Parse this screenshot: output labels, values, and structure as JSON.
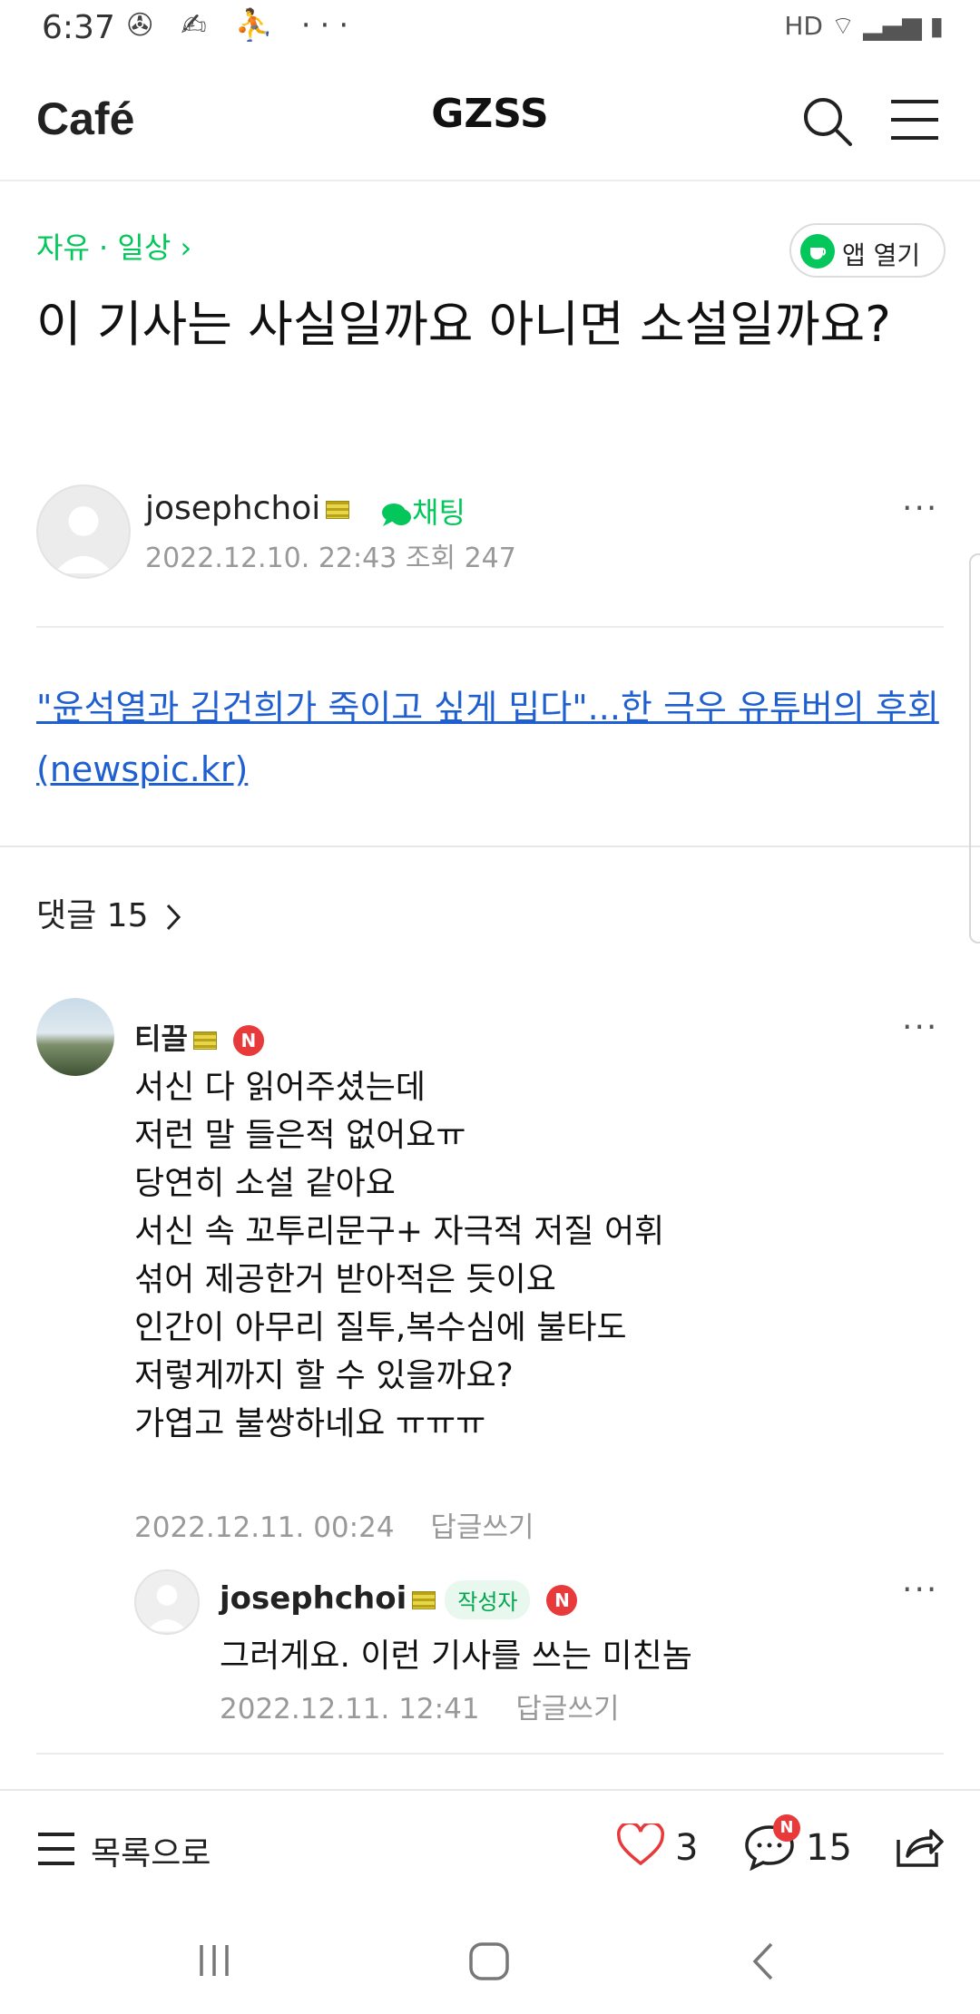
{
  "status": {
    "time": "6:37",
    "notification_icons": "✇ ✍ ⛹ ···",
    "right_icons": "HD ⌔ ▂▄▆ ▮"
  },
  "header": {
    "logo": "Café",
    "cafe_name": "GZSS"
  },
  "post": {
    "board": "자유 · 일상 ›",
    "app_open_label": "앱 열기",
    "title": "이 기사는 사실일까요 아니면 소설일까요?",
    "author": "josephchoi",
    "chat_label": "채팅",
    "date": "2022.12.10. 22:43",
    "views": "조회 247",
    "link_text": "\"윤석열과 김건희가 죽이고 싶게 밉다\"...한 극우 유튜버의 후회 (newspic.kr)",
    "comment_count_label": "댓글 15"
  },
  "comments": [
    {
      "name": "티끌",
      "new_badge": "N",
      "lines": [
        "서신 다 읽어주셨는데",
        "저런 말 들은적 없어요ㅠ",
        "당연히 소설 같아요",
        "서신 속 꼬투리문구+ 자극적 저질 어휘",
        "섞어 제공한거 받아적은 듯이요",
        "인간이 아무리 질투,복수심에 불타도",
        "저렇게까지 할 수 있을까요?",
        "가엽고 불쌍하네요 ㅠㅠㅠ"
      ],
      "date": "2022.12.11. 00:24",
      "reply_label": "답글쓰기"
    }
  ],
  "reply": {
    "name": "josephchoi",
    "author_tag": "작성자",
    "new_badge": "N",
    "body": "그러게요. 이런 기사를 쓰는 미친놈",
    "date": "2022.12.11. 12:41",
    "reply_label": "답글쓰기"
  },
  "bottom_bar": {
    "list_label": "목록으로",
    "like_count": "3",
    "comment_count": "15",
    "comment_badge": "N"
  },
  "colors": {
    "accent_green": "#03c75a",
    "link_blue": "#1f5fcf",
    "badge_red": "#e8393b"
  }
}
